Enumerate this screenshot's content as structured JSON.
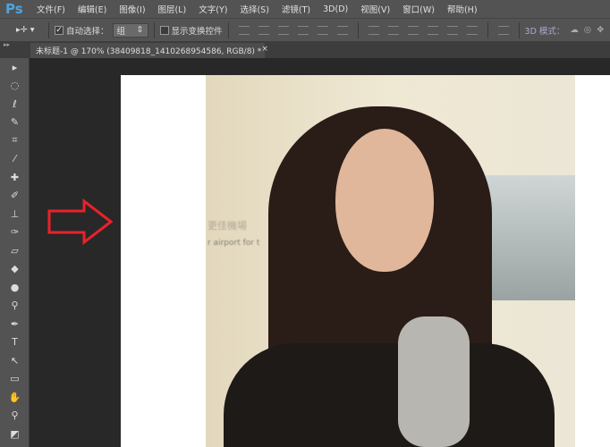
{
  "app": {
    "logo": "Ps"
  },
  "menu": [
    "文件(F)",
    "编辑(E)",
    "图像(I)",
    "图层(L)",
    "文字(Y)",
    "选择(S)",
    "滤镜(T)",
    "3D(D)",
    "视图(V)",
    "窗口(W)",
    "帮助(H)"
  ],
  "options": {
    "auto_select_label": "自动选择：",
    "auto_select_checked": true,
    "auto_select_value": "组",
    "show_transform_label": "显示变换控件",
    "show_transform_checked": false,
    "mode_3d_label": "3D 模式："
  },
  "document_tab": {
    "title": "未标题-1 @ 170% (38409818_1410268954586, RGB/8) *",
    "close": "×"
  },
  "photo": {
    "sign_cn": "更佳機場",
    "sign_en": "r airport for t"
  },
  "colors": {
    "arrow": "#e8222a",
    "accent": "#4fa3e0"
  }
}
